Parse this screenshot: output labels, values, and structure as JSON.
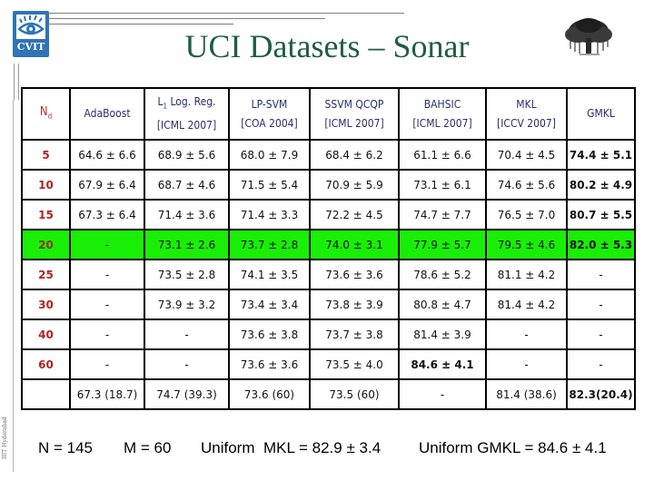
{
  "header": {
    "logo_left_text": "CVIT",
    "title": "UCI Datasets – Sonar"
  },
  "table": {
    "columns": [
      {
        "line1": "N",
        "sub": "d"
      },
      {
        "line1": "AdaBoost",
        "line2": ""
      },
      {
        "line1": "L",
        "sub": "1",
        "line1_rest": " Log. Reg.",
        "line2": "[ICML 2007]"
      },
      {
        "line1": "LP-SVM",
        "line2": "[COA 2004]"
      },
      {
        "line1": "SSVM QCQP",
        "line2": "[ICML 2007]"
      },
      {
        "line1": "BAHSIC",
        "line2": "[ICML 2007]"
      },
      {
        "line1": "MKL",
        "line2": "[ICCV 2007]"
      },
      {
        "line1": "GMKL",
        "line2": ""
      }
    ],
    "rows": [
      {
        "nd": "5",
        "cells": [
          "64.6 ±  6.6",
          "68.9 ± 5.6",
          "68.0 ± 7.9",
          "68.4 ± 6.2",
          "61.1 ± 6.6",
          "70.4 ± 4.5",
          "74.4 ± 5.1"
        ]
      },
      {
        "nd": "10",
        "cells": [
          "67.9 ± 6.4",
          "68.7 ± 4.6",
          "71.5 ± 5.4",
          "70.9 ± 5.9",
          "73.1 ± 6.1",
          "74.6 ± 5.6",
          "80.2 ± 4.9"
        ]
      },
      {
        "nd": "15",
        "cells": [
          "67.3 ± 6.4",
          "71.4 ± 3.6",
          "71.4 ± 3.3",
          "72.2 ± 4.5",
          "74.7 ± 7.7",
          "76.5 ± 7.0",
          "80.7 ± 5.5"
        ]
      },
      {
        "nd": "20",
        "cells": [
          "-",
          "73.1 ± 2.6",
          "73.7 ± 2.8",
          "74.0 ± 3.1",
          "77.9 ± 5.7",
          "79.5 ± 4.6",
          "82.0 ± 5.3"
        ],
        "highlight": true
      },
      {
        "nd": "25",
        "cells": [
          "-",
          "73.5 ± 2.8",
          "74.1 ± 3.5",
          "73.6 ± 3.6",
          "78.6 ± 5.2",
          "81.1 ± 4.2",
          "-"
        ]
      },
      {
        "nd": "30",
        "cells": [
          "-",
          "73.9 ± 3.2",
          "73.4 ± 3.4",
          "73.8 ± 3.9",
          "80.8 ± 4.7",
          "81.4 ± 4.2",
          "-"
        ]
      },
      {
        "nd": "40",
        "cells": [
          "-",
          "-",
          "73.6 ± 3.8",
          "73.7 ± 3.8",
          "81.4 ± 3.9",
          "-",
          "-"
        ]
      },
      {
        "nd": "60",
        "cells": [
          "-",
          "-",
          "73.6 ± 3.6",
          "73.5 ± 4.0",
          "84.6 ± 4.1",
          "-",
          "-"
        ]
      },
      {
        "nd": "",
        "cells": [
          "67.3 (18.7)",
          "74.7 (39.3)",
          "73.6 (60)",
          "73.5 (60)",
          "-",
          "81.4 (38.6)",
          "82.3(20.4)"
        ]
      }
    ],
    "highlight_color": "#19ef06"
  },
  "footer": {
    "n": "N = 145",
    "m": "M = 60",
    "uniform_mkl": "Uniform  MKL = 82.9 ± 3.4",
    "uniform_gmkl": "Uniform GMKL = 84.6 ± 4.1"
  },
  "side_label": "IIIT Hyderabad"
}
